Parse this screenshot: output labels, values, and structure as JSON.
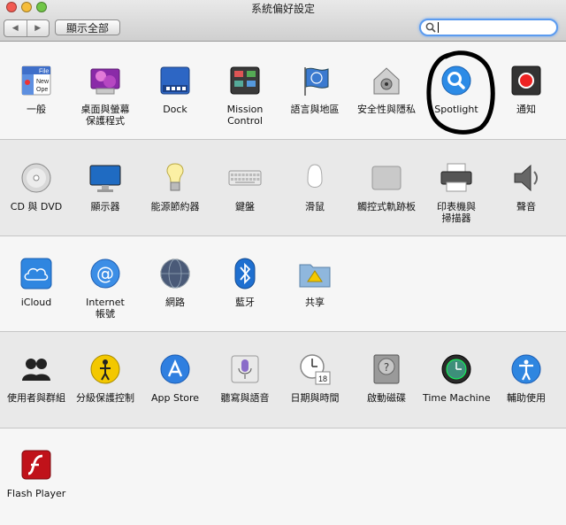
{
  "window": {
    "title": "系統偏好設定",
    "back_glyph": "◀",
    "forward_glyph": "▶",
    "show_all_label": "顯示全部",
    "search": {
      "value": "",
      "placeholder": ""
    }
  },
  "colors": {
    "search_focus": "#5b9bef",
    "close_light": "#f25b52",
    "minimize_light": "#f5bd3b",
    "zoom_light": "#71c646",
    "annotation_circle": "#000000"
  },
  "sections": [
    {
      "panes": [
        {
          "label": "一般",
          "icon": "general-icon"
        },
        {
          "label": "桌面與螢幕\n保護程式",
          "icon": "desktop-screensaver-icon"
        },
        {
          "label": "Dock",
          "icon": "dock-icon"
        },
        {
          "label": "Mission\nControl",
          "icon": "mission-control-icon"
        },
        {
          "label": "語言與地區",
          "icon": "language-region-icon"
        },
        {
          "label": "安全性與隱私",
          "icon": "security-privacy-icon"
        },
        {
          "label": "Spotlight",
          "icon": "spotlight-icon"
        },
        {
          "label": "通知",
          "icon": "notifications-icon"
        }
      ]
    },
    {
      "panes": [
        {
          "label": "CD 與 DVD",
          "icon": "cd-dvd-icon"
        },
        {
          "label": "顯示器",
          "icon": "displays-icon"
        },
        {
          "label": "能源節約器",
          "icon": "energy-saver-icon"
        },
        {
          "label": "鍵盤",
          "icon": "keyboard-icon"
        },
        {
          "label": "滑鼠",
          "icon": "mouse-icon"
        },
        {
          "label": "觸控式軌跡板",
          "icon": "trackpad-icon"
        },
        {
          "label": "印表機與\n掃描器",
          "icon": "printers-scanners-icon"
        },
        {
          "label": "聲音",
          "icon": "sound-icon"
        }
      ]
    },
    {
      "panes": [
        {
          "label": "iCloud",
          "icon": "icloud-icon"
        },
        {
          "label": "Internet\n帳號",
          "icon": "internet-accounts-icon"
        },
        {
          "label": "網路",
          "icon": "network-icon"
        },
        {
          "label": "藍牙",
          "icon": "bluetooth-icon"
        },
        {
          "label": "共享",
          "icon": "sharing-icon"
        }
      ]
    },
    {
      "panes": [
        {
          "label": "使用者與群組",
          "icon": "users-groups-icon"
        },
        {
          "label": "分級保護控制",
          "icon": "parental-controls-icon"
        },
        {
          "label": "App Store",
          "icon": "app-store-icon"
        },
        {
          "label": "聽寫與語音",
          "icon": "dictation-speech-icon"
        },
        {
          "label": "日期與時間",
          "icon": "date-time-icon"
        },
        {
          "label": "啟動磁碟",
          "icon": "startup-disk-icon"
        },
        {
          "label": "Time Machine",
          "icon": "time-machine-icon"
        },
        {
          "label": "輔助使用",
          "icon": "accessibility-icon"
        }
      ]
    },
    {
      "panes": [
        {
          "label": "Flash Player",
          "icon": "flash-player-icon"
        }
      ]
    }
  ],
  "icon_text": {
    "general": [
      "File",
      "New",
      "Ope"
    ],
    "calendar_day": "18",
    "keyboard_key": "?"
  }
}
